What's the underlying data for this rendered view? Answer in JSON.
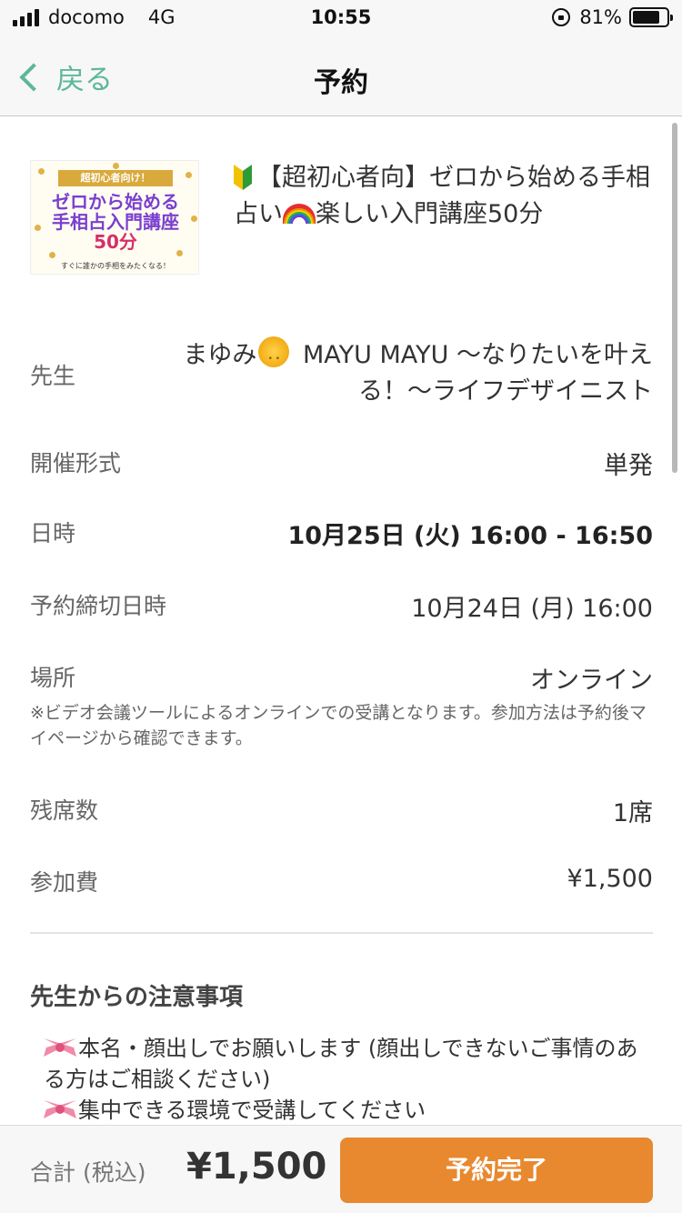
{
  "status_bar": {
    "carrier": "docomo",
    "network": "4G",
    "time": "10:55",
    "battery": "81%",
    "battery_level": 0.81
  },
  "nav": {
    "back_label": "戻る",
    "title": "予約"
  },
  "course": {
    "thumbnail": {
      "top_text": "超初心者向け！",
      "line1": "ゼロから始める",
      "line2": "手相占入門講座",
      "line3": "50分",
      "footer_text": "すぐに誰かの手相をみたくなる！"
    },
    "title_part1": "【超初心者向】ゼロから始める手相占い",
    "title_part2": "楽しい入門講座50分",
    "icons": [
      "beginner-mark-icon",
      "rainbow-icon"
    ]
  },
  "details": {
    "teacher_label": "先生",
    "teacher_name_part1": "まゆみ",
    "teacher_name_part2": "MAYU MAYU 〜なりたいを叶える！〜ライフデザイニスト",
    "format_label": "開催形式",
    "format_value": "単発",
    "datetime_label": "日時",
    "datetime_value": "10月25日 (火) 16:00 - 16:50",
    "deadline_label": "予約締切日時",
    "deadline_value": "10月24日 (月) 16:00",
    "location_label": "場所",
    "location_value": "オンライン",
    "location_note": "※ビデオ会議ツールによるオンラインでの受講となります。参加方法は予約後マイページから確認できます。",
    "seats_label": "残席数",
    "seats_value": "1席",
    "fee_label": "参加費",
    "fee_value": "¥1,500"
  },
  "notes": {
    "heading": "先生からの注意事項",
    "line1": "本名・顔出しでお願いします (顔出しできないご事情のある方はご相談ください)",
    "line2": "集中できる環境で受講してください"
  },
  "footer": {
    "total_label": "合計 (税込)",
    "total_value": "¥1,500",
    "book_button": "予約完了"
  },
  "colors": {
    "accent_green": "#5cb897",
    "book_button_orange": "#e8892f"
  }
}
